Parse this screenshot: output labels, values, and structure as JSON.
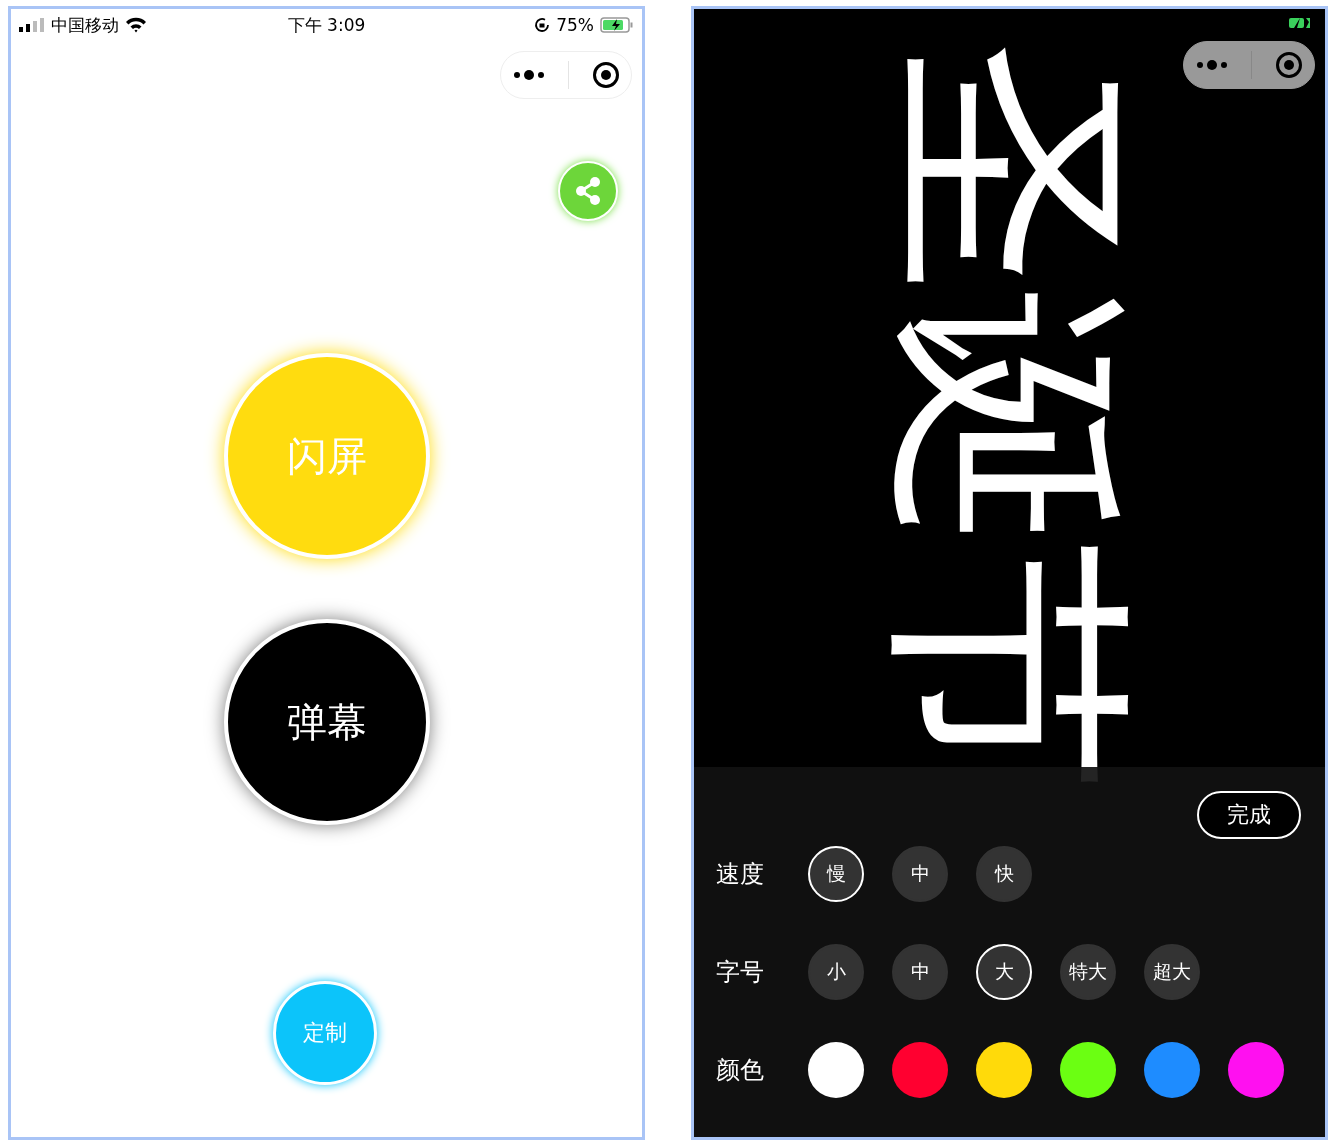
{
  "left_screen": {
    "status_bar": {
      "carrier": "中国移动",
      "time": "下午 3:09",
      "battery": "75%"
    },
    "buttons": [
      {
        "label": "闪屏",
        "kind": "large",
        "color": "#ffdc0f"
      },
      {
        "label": "弹幕",
        "kind": "large",
        "color": "#000000"
      },
      {
        "label": "定制",
        "kind": "small",
        "color": "#0cc4fa"
      }
    ]
  },
  "right_screen": {
    "banner_text": "圣诞节",
    "done_button": "完成",
    "settings": [
      {
        "label": "速度",
        "kind": "options",
        "options": [
          {
            "label": "慢",
            "selected": true
          },
          {
            "label": "中",
            "selected": false
          },
          {
            "label": "快",
            "selected": false
          }
        ]
      },
      {
        "label": "字号",
        "kind": "options",
        "options": [
          {
            "label": "小",
            "selected": false
          },
          {
            "label": "中",
            "selected": false
          },
          {
            "label": "大",
            "selected": true
          },
          {
            "label": "特大",
            "selected": false
          },
          {
            "label": "超大",
            "selected": false
          }
        ]
      },
      {
        "label": "颜色",
        "kind": "swatches",
        "swatches": [
          {
            "color": "#ffffff"
          },
          {
            "color": "#ff0030"
          },
          {
            "color": "#ffda0a"
          },
          {
            "color": "#6bff12"
          },
          {
            "color": "#1e8cff"
          },
          {
            "color": "#ff10f0"
          }
        ]
      }
    ]
  }
}
